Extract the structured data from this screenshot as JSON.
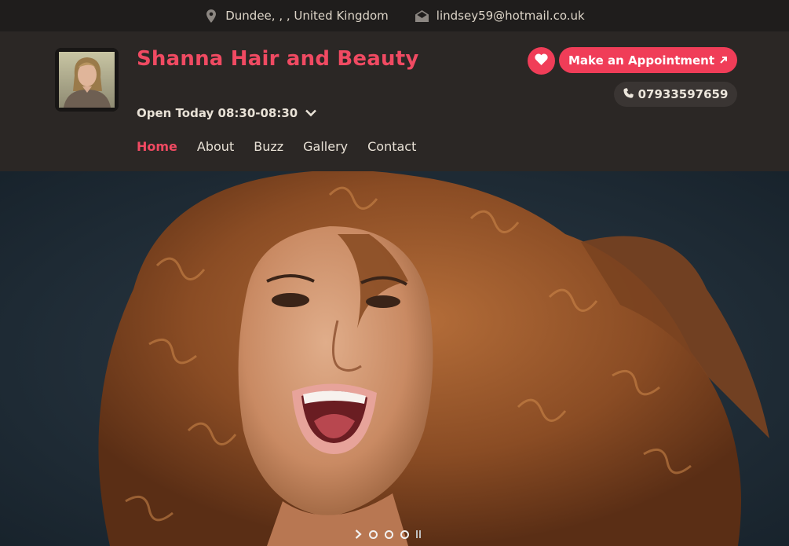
{
  "topbar": {
    "location": "Dundee, , , United Kingdom",
    "email": "lindsey59@hotmail.co.uk",
    "location_icon": "map-pin-icon",
    "email_icon": "envelope-icon"
  },
  "header": {
    "business_name": "Shanna Hair and Beauty",
    "open_today": "Open Today 08:30-08:30",
    "appointment_label": "Make an Appointment",
    "phone": "07933597659",
    "favorite_icon": "heart-icon",
    "appointment_icon": "external-arrow-icon",
    "phone_icon": "phone-icon",
    "hours_toggle_icon": "chevron-down-icon"
  },
  "nav": {
    "items": [
      {
        "label": "Home",
        "active": true
      },
      {
        "label": "About",
        "active": false
      },
      {
        "label": "Buzz",
        "active": false
      },
      {
        "label": "Gallery",
        "active": false
      },
      {
        "label": "Contact",
        "active": false
      }
    ]
  },
  "slider": {
    "slide_count": 3,
    "next_icon": "chevron-right-icon",
    "pause_icon": "pause-icon"
  },
  "colors": {
    "accent": "#f04a62",
    "header_bg": "#2b2725",
    "topbar_bg": "#1f1d1c"
  }
}
